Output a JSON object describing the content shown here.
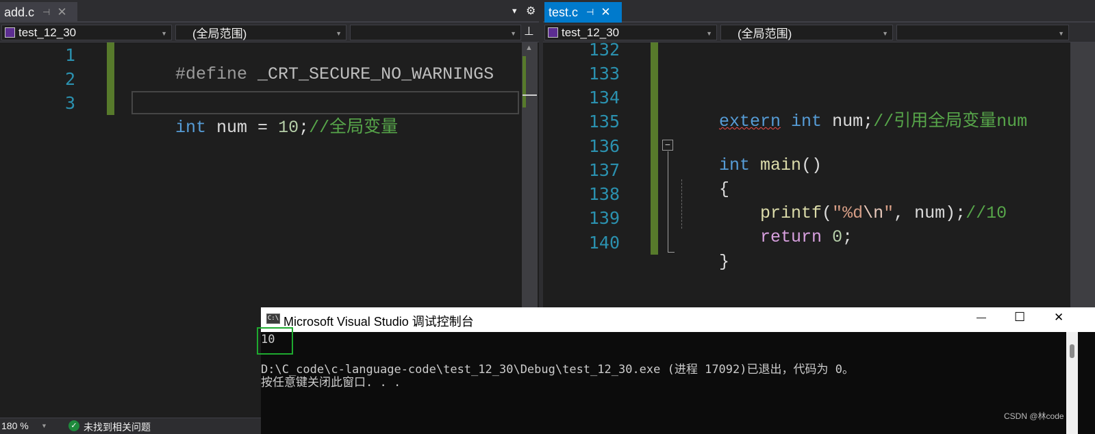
{
  "left_editor": {
    "tab": {
      "title": "add.c",
      "pin": "⊣",
      "close": "✕"
    },
    "tab_menu": {
      "dropdown": "▾",
      "settings": "⚙"
    },
    "nav": {
      "project": "test_12_30",
      "scope": "(全局范围)",
      "member": "",
      "split_glyph": "⊥"
    },
    "lines": [
      {
        "n": "1",
        "tokens": [
          {
            "t": "#define ",
            "c": "pp"
          },
          {
            "t": "_CRT_SECURE_NO_WARNINGS",
            "c": "macro"
          }
        ]
      },
      {
        "n": "2",
        "tokens": []
      },
      {
        "n": "3",
        "tokens": [
          {
            "t": "int",
            "c": "kw"
          },
          {
            "t": " num = ",
            "c": "txt"
          },
          {
            "t": "10",
            "c": "num"
          },
          {
            "t": ";",
            "c": "txt"
          },
          {
            "t": "//全局变量",
            "c": "cmt"
          }
        ]
      }
    ],
    "scroll_up": "▲"
  },
  "right_editor": {
    "tab": {
      "title": "test.c",
      "pin": "⊣",
      "close": "✕"
    },
    "nav": {
      "project": "test_12_30",
      "scope": "(全局范围)",
      "member": ""
    },
    "lines": [
      {
        "n": "132",
        "tokens": []
      },
      {
        "n": "133",
        "tokens": []
      },
      {
        "n": "134",
        "tokens": [
          {
            "t": "extern",
            "c": "kw squig"
          },
          {
            "t": " ",
            "c": "txt"
          },
          {
            "t": "int",
            "c": "kw"
          },
          {
            "t": " num;",
            "c": "txt"
          },
          {
            "t": "//引用全局变量num",
            "c": "cmt"
          }
        ]
      },
      {
        "n": "135",
        "tokens": []
      },
      {
        "n": "136",
        "tokens": [
          {
            "t": "int",
            "c": "kw"
          },
          {
            "t": " ",
            "c": "txt"
          },
          {
            "t": "main",
            "c": "fn"
          },
          {
            "t": "()",
            "c": "txt"
          }
        ]
      },
      {
        "n": "137",
        "tokens": [
          {
            "t": "{",
            "c": "txt"
          }
        ]
      },
      {
        "n": "138",
        "tokens": [
          {
            "t": "    ",
            "c": "txt"
          },
          {
            "t": "printf",
            "c": "fn"
          },
          {
            "t": "(",
            "c": "txt"
          },
          {
            "t": "\"%d",
            "c": "str"
          },
          {
            "t": "\\n",
            "c": "esc"
          },
          {
            "t": "\"",
            "c": "str"
          },
          {
            "t": ", num);",
            "c": "txt"
          },
          {
            "t": "//10",
            "c": "cmt"
          }
        ]
      },
      {
        "n": "139",
        "tokens": [
          {
            "t": "    ",
            "c": "txt"
          },
          {
            "t": "return",
            "c": "ret"
          },
          {
            "t": " ",
            "c": "txt"
          },
          {
            "t": "0",
            "c": "num"
          },
          {
            "t": ";",
            "c": "txt"
          }
        ]
      },
      {
        "n": "140",
        "tokens": [
          {
            "t": "}",
            "c": "txt"
          }
        ]
      }
    ],
    "collapse_glyph": "−"
  },
  "statusbar": {
    "zoom": "180 %",
    "issues": "未找到相关问题"
  },
  "console": {
    "icon_text": "C:\\",
    "title": "Microsoft Visual Studio 调试控制台",
    "minimize": "—",
    "maximize": "☐",
    "close": "✕",
    "output": "10",
    "exit_line": "D:\\C_code\\c-language-code\\test_12_30\\Debug\\test_12_30.exe (进程 17092)已退出，代码为 0。",
    "press_line": "按任意键关闭此窗口. . .",
    "watermark": "CSDN @林code"
  },
  "colors": {
    "accent": "#007acc",
    "changebar": "#577a2b",
    "keyword": "#569cd6",
    "comment": "#57a64a",
    "linenumber": "#2b91af"
  }
}
